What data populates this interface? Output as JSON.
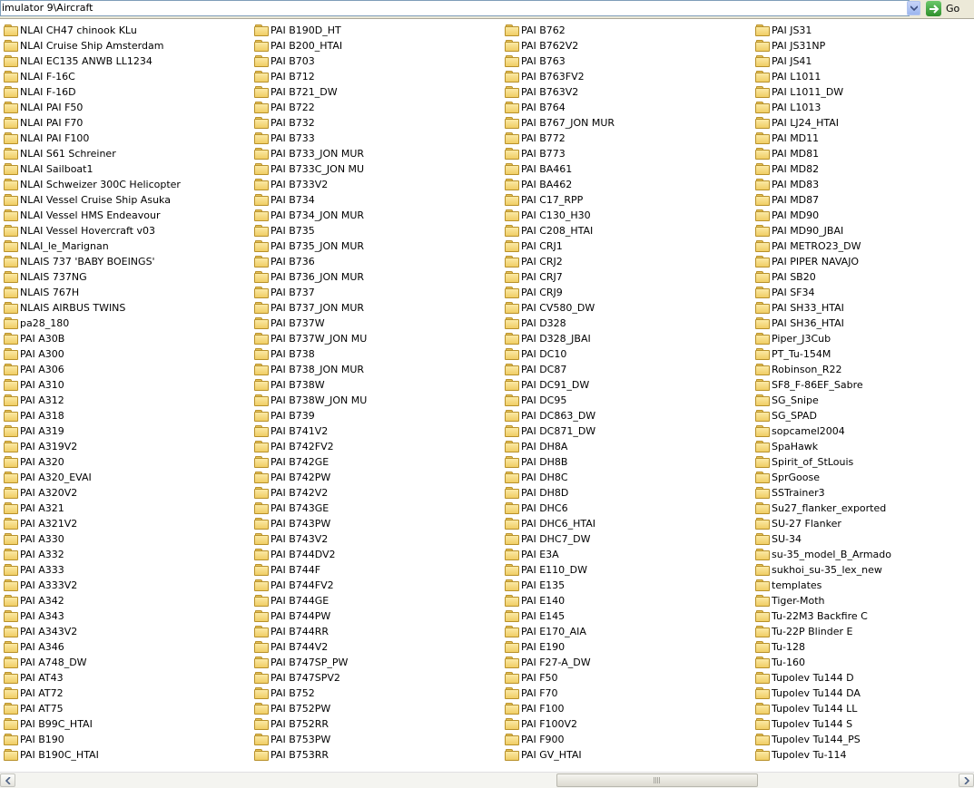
{
  "address_bar": {
    "path": "imulator 9\\Aircraft"
  },
  "go_button": {
    "label": "Go"
  },
  "colors": {
    "folder": "#f0cd64",
    "go": "#2e8f2b"
  },
  "columns": [
    [
      "NLAI CH47 chinook KLu",
      "NLAI Cruise Ship Amsterdam",
      "NLAI EC135 ANWB LL1234",
      "NLAI F-16C",
      "NLAI F-16D",
      "NLAI PAI F50",
      "NLAI PAI F70",
      "NLAI PAI F100",
      "NLAI S61 Schreiner",
      "NLAI Sailboat1",
      "NLAI Schweizer 300C Helicopter",
      "NLAI Vessel Cruise Ship Asuka",
      "NLAI Vessel HMS Endeavour",
      "NLAI Vessel Hovercraft v03",
      "NLAI_le_Marignan",
      "NLAIS 737 'BABY BOEINGS'",
      "NLAIS 737NG",
      "NLAIS 767H",
      "NLAIS AIRBUS TWINS",
      "pa28_180",
      "PAI A30B",
      "PAI A300",
      "PAI A306",
      "PAI A310",
      "PAI A312",
      "PAI A318",
      "PAI A319",
      "PAI A319V2",
      "PAI A320",
      "PAI A320_EVAI",
      "PAI A320V2",
      "PAI A321",
      "PAI A321V2",
      "PAI A330",
      "PAI A332",
      "PAI A333",
      "PAI A333V2",
      "PAI A342",
      "PAI A343",
      "PAI A343V2",
      "PAI A346",
      "PAI A748_DW",
      "PAI AT43",
      "PAI AT72",
      "PAI AT75",
      "PAI B99C_HTAI",
      "PAI B190",
      "PAI B190C_HTAI"
    ],
    [
      "PAI B190D_HT",
      "PAI B200_HTAI",
      "PAI B703",
      "PAI B712",
      "PAI B721_DW",
      "PAI B722",
      "PAI B732",
      "PAI B733",
      "PAI B733_JON MUR",
      "PAI B733C_JON MU",
      "PAI B733V2",
      "PAI B734",
      "PAI B734_JON MUR",
      "PAI B735",
      "PAI B735_JON MUR",
      "PAI B736",
      "PAI B736_JON MUR",
      "PAI B737",
      "PAI B737_JON MUR",
      "PAI B737W",
      "PAI B737W_JON MU",
      "PAI B738",
      "PAI B738_JON MUR",
      "PAI B738W",
      "PAI B738W_JON MU",
      "PAI B739",
      "PAI B741V2",
      "PAI B742FV2",
      "PAI B742GE",
      "PAI B742PW",
      "PAI B742V2",
      "PAI B743GE",
      "PAI B743PW",
      "PAI B743V2",
      "PAI B744DV2",
      "PAI B744F",
      "PAI B744FV2",
      "PAI B744GE",
      "PAI B744PW",
      "PAI B744RR",
      "PAI B744V2",
      "PAI B747SP_PW",
      "PAI B747SPV2",
      "PAI B752",
      "PAI B752PW",
      "PAI B752RR",
      "PAI B753PW",
      "PAI B753RR"
    ],
    [
      "PAI B762",
      "PAI B762V2",
      "PAI B763",
      "PAI B763FV2",
      "PAI B763V2",
      "PAI B764",
      "PAI B767_JON MUR",
      "PAI B772",
      "PAI B773",
      "PAI BA461",
      "PAI BA462",
      "PAI C17_RPP",
      "PAI C130_H30",
      "PAI C208_HTAI",
      "PAI CRJ1",
      "PAI CRJ2",
      "PAI CRJ7",
      "PAI CRJ9",
      "PAI CV580_DW",
      "PAI D328",
      "PAI D328_JBAI",
      "PAI DC10",
      "PAI DC87",
      "PAI DC91_DW",
      "PAI DC95",
      "PAI DC863_DW",
      "PAI DC871_DW",
      "PAI DH8A",
      "PAI DH8B",
      "PAI DH8C",
      "PAI DH8D",
      "PAI DHC6",
      "PAI DHC6_HTAI",
      "PAI DHC7_DW",
      "PAI E3A",
      "PAI E110_DW",
      "PAI E135",
      "PAI E140",
      "PAI E145",
      "PAI E170_AIA",
      "PAI E190",
      "PAI F27-A_DW",
      "PAI F50",
      "PAI F70",
      "PAI F100",
      "PAI F100V2",
      "PAI F900",
      "PAI GV_HTAI"
    ],
    [
      "PAI JS31",
      "PAI JS31NP",
      "PAI JS41",
      "PAI L1011",
      "PAI L1011_DW",
      "PAI L1013",
      "PAI LJ24_HTAI",
      "PAI MD11",
      "PAI MD81",
      "PAI MD82",
      "PAI MD83",
      "PAI MD87",
      "PAI MD90",
      "PAI MD90_JBAI",
      "PAI METRO23_DW",
      "PAI PIPER NAVAJO",
      "PAI SB20",
      "PAI SF34",
      "PAI SH33_HTAI",
      "PAI SH36_HTAI",
      "Piper_J3Cub",
      "PT_Tu-154M",
      "Robinson_R22",
      "SF8_F-86EF_Sabre",
      "SG_Snipe",
      "SG_SPAD",
      "sopcamel2004",
      "SpaHawk",
      "Spirit_of_StLouis",
      "SprGoose",
      "SSTrainer3",
      "Su27_flanker_exported",
      "SU-27 Flanker",
      "SU-34",
      "su-35_model_B_Armado",
      "sukhoi_su-35_lex_new",
      "templates",
      "Tiger-Moth",
      "Tu-22M3 Backfire C",
      "Tu-22P Blinder E",
      "Tu-128",
      "Tu-160",
      "Tupolev Tu144 D",
      "Tupolev Tu144 DA",
      "Tupolev Tu144 LL",
      "Tupolev Tu144 S",
      "Tupolev Tu144_PS",
      "Tupolev Tu-114"
    ]
  ]
}
